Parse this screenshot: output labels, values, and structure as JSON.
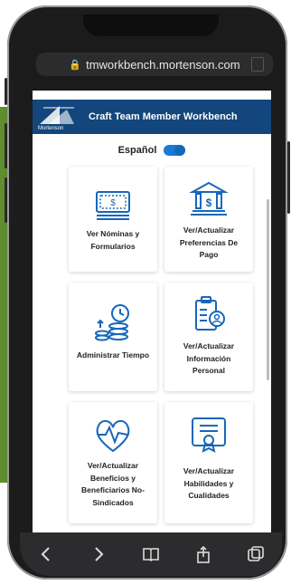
{
  "browser": {
    "url": "tmworkbench.mortenson.com"
  },
  "header": {
    "brand": "Mortenson",
    "title": "Craft Team Member Workbench"
  },
  "language": {
    "label": "Español",
    "toggle_on": true
  },
  "tiles": [
    {
      "label": "Ver Nóminas y Formularios",
      "icon": "paycheck-icon"
    },
    {
      "label": "Ver/Actualizar Preferencias De Pago",
      "icon": "bank-icon"
    },
    {
      "label": "Administrar Tiempo",
      "icon": "clock-coins-icon"
    },
    {
      "label": "Ver/Actualizar Información Personal",
      "icon": "personal-info-icon"
    },
    {
      "label": "Ver/Actualizar Beneficios y Beneficiarios No-Sindicados",
      "icon": "heart-pulse-icon"
    },
    {
      "label": "Ver/Actualizar Habilidades y Cualidades",
      "icon": "certificate-icon"
    }
  ],
  "colors": {
    "brand_blue": "#12467c",
    "toggle_blue": "#1b7ad6",
    "icon_blue": "#1767b9",
    "side_green": "#5e8e2c"
  },
  "toolbar": {
    "back": "back-icon",
    "forward": "forward-icon",
    "bookmarks": "book-icon",
    "share": "share-icon",
    "tabs": "tabs-icon"
  }
}
